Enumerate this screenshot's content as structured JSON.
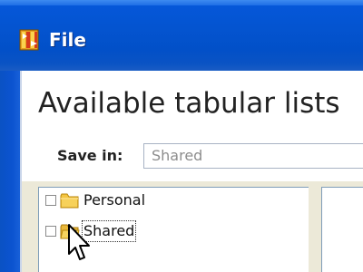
{
  "window": {
    "title": "File",
    "app_icon": "file-app-icon"
  },
  "dialog": {
    "heading": "Available tabular lists"
  },
  "save_in": {
    "label": "Save in:",
    "value": "Shared"
  },
  "tree": {
    "items": [
      {
        "label": "Personal",
        "icon": "folder-icon",
        "checked": false,
        "selected": false
      },
      {
        "label": "Shared",
        "icon": "folder-open-icon",
        "checked": false,
        "selected": true
      }
    ]
  },
  "cursor": {
    "icon": "arrow-cursor-icon"
  }
}
